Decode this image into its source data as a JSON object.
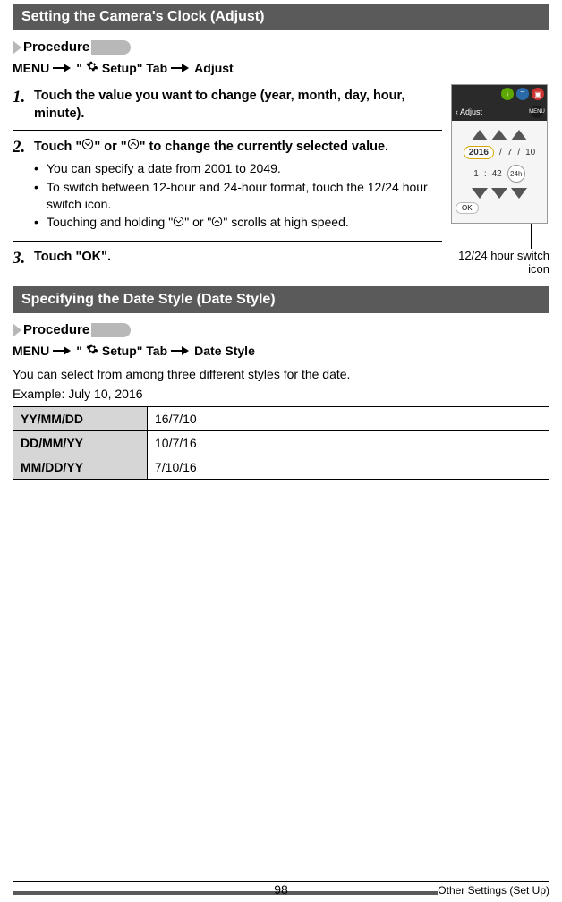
{
  "section1": {
    "title": "Setting the Camera's Clock (Adjust)",
    "procedure_label": "Procedure",
    "menu_path": {
      "p1": "MENU",
      "p2": "\"",
      "p2b": " Setup\" Tab",
      "p3": "Adjust"
    },
    "step1": {
      "num": "1.",
      "text": "Touch the value you want to change (year, month, day, hour, minute)."
    },
    "step2": {
      "num": "2.",
      "text_a": "Touch \"",
      "text_b": "\" or \"",
      "text_c": "\" to change the currently selected value.",
      "bullets": [
        "You can specify a date from 2001 to 2049.",
        "To switch between 12-hour and 24-hour format, touch the 12/24 hour switch icon.",
        "Touching and holding \"⌄\" or \"⌃\" scrolls at high speed."
      ],
      "b3_a": "Touching and holding \"",
      "b3_b": "\" or \"",
      "b3_c": "\" scrolls at high speed."
    },
    "step3": {
      "num": "3.",
      "text": "Touch \"OK\"."
    },
    "callout": "12/24 hour switch icon",
    "mini": {
      "header": "Adjust",
      "menu": "MENU",
      "year": "2016",
      "month": "7",
      "day": "10",
      "hour": "1",
      "min": "42",
      "fmt": "24h",
      "ok": "OK"
    }
  },
  "section2": {
    "title": "Specifying the Date Style (Date Style)",
    "procedure_label": "Procedure",
    "menu_path": {
      "p1": "MENU",
      "p2": "\"",
      "p2b": " Setup\" Tab",
      "p3": "Date Style"
    },
    "desc": "You can select from among three different styles for the date.",
    "example": "Example: July 10, 2016",
    "rows": [
      {
        "hdr": "YY/MM/DD",
        "val": "16/7/10"
      },
      {
        "hdr": "DD/MM/YY",
        "val": "10/7/16"
      },
      {
        "hdr": "MM/DD/YY",
        "val": "7/10/16"
      }
    ]
  },
  "footer": {
    "page": "98",
    "section": "Other Settings (Set Up)"
  }
}
